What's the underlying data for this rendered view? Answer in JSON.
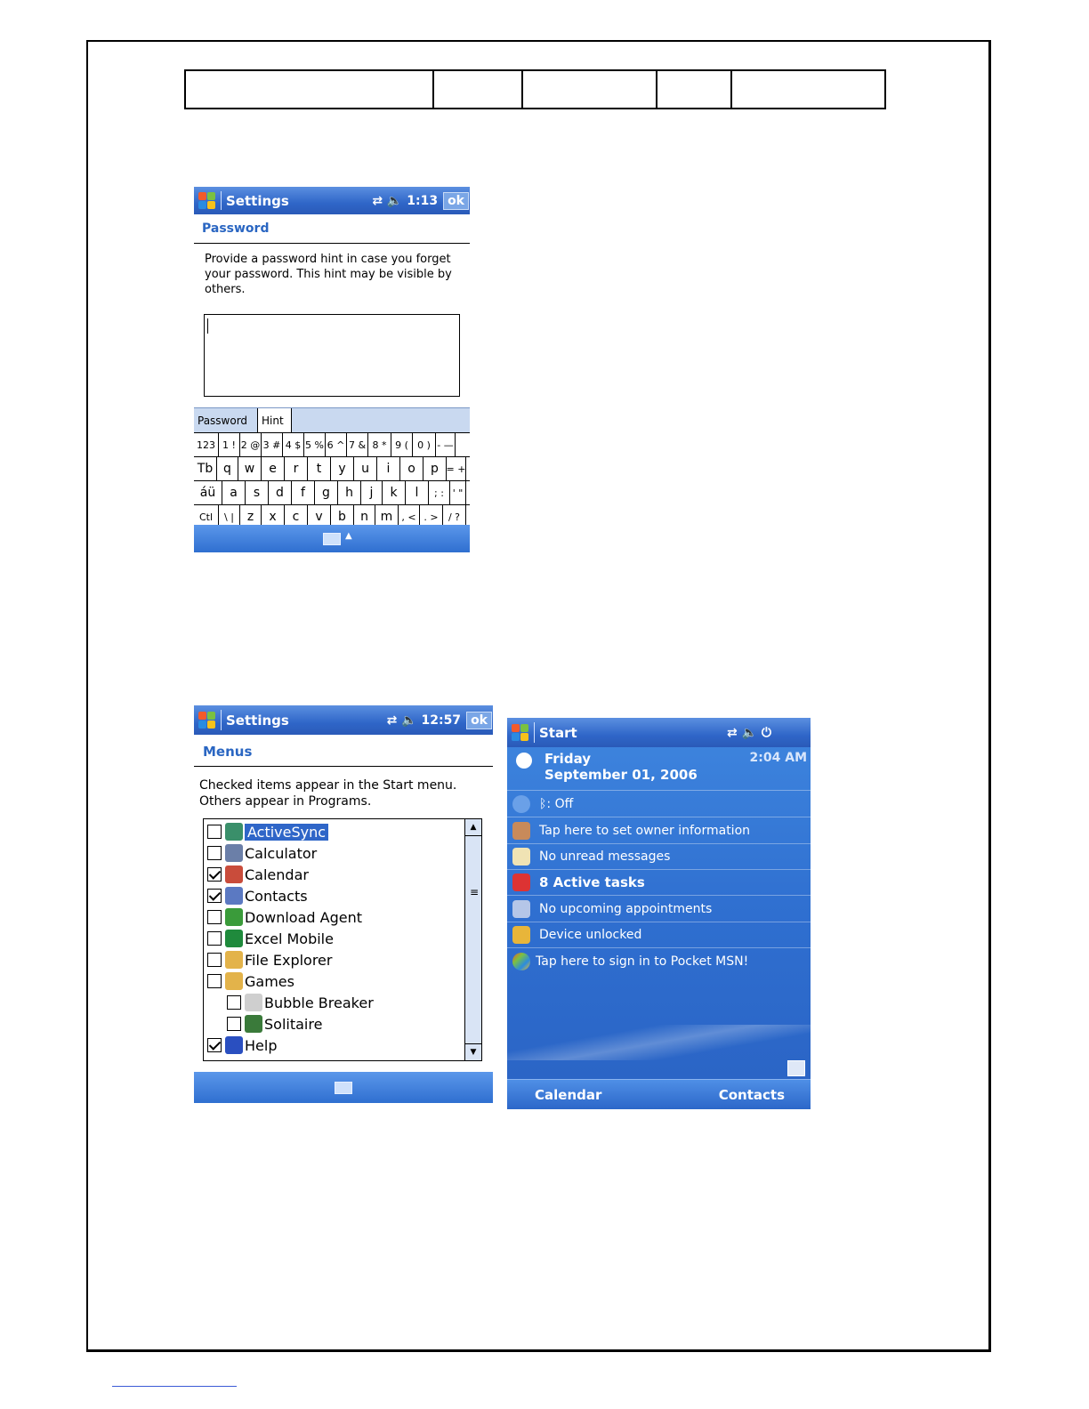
{
  "screen1": {
    "app_title": "Settings",
    "time": "1:13",
    "ok": "ok",
    "heading": "Password",
    "hint_text": "Provide a password hint in case you forget your password.  This hint may be visible by others.",
    "tabs": [
      "Password",
      "Hint"
    ],
    "keyboard_rows": [
      [
        "123",
        "1 !",
        "2 @",
        "3 #",
        "4 $",
        "5 %",
        "6 ^",
        "7 &",
        "8 *",
        "9 (",
        "0 )",
        "- —"
      ],
      [
        "Tb",
        "q",
        "w",
        "e",
        "r",
        "t",
        "y",
        "u",
        "i",
        "o",
        "p",
        "= +"
      ],
      [
        "áü",
        "a",
        "s",
        "d",
        "f",
        "g",
        "h",
        "j",
        "k",
        "l",
        "; :",
        "' \""
      ],
      [
        "Ctl",
        "\\ |",
        "z",
        "x",
        "c",
        "v",
        "b",
        "n",
        "m",
        ", <",
        ". >",
        "/ ?"
      ]
    ]
  },
  "screen2": {
    "app_title": "Settings",
    "time": "12:57",
    "ok": "ok",
    "heading": "Menus",
    "description": "Checked items appear in the Start menu. Others appear in Programs.",
    "items": [
      {
        "label": "ActiveSync",
        "checked": false,
        "indent": false,
        "selected": true,
        "color": "#3a8f6a"
      },
      {
        "label": "Calculator",
        "checked": false,
        "indent": false,
        "selected": false,
        "color": "#6b7fa8"
      },
      {
        "label": "Calendar",
        "checked": true,
        "indent": false,
        "selected": false,
        "color": "#c94c3b"
      },
      {
        "label": "Contacts",
        "checked": true,
        "indent": false,
        "selected": false,
        "color": "#5b79c2"
      },
      {
        "label": "Download Agent",
        "checked": false,
        "indent": false,
        "selected": false,
        "color": "#3a9b3a"
      },
      {
        "label": "Excel Mobile",
        "checked": false,
        "indent": false,
        "selected": false,
        "color": "#1f8a3c"
      },
      {
        "label": "File Explorer",
        "checked": false,
        "indent": false,
        "selected": false,
        "color": "#e3b34a"
      },
      {
        "label": "Games",
        "checked": false,
        "indent": false,
        "selected": false,
        "color": "#e3b34a"
      },
      {
        "label": "Bubble Breaker",
        "checked": false,
        "indent": true,
        "selected": false,
        "color": "#cfcfcf"
      },
      {
        "label": "Solitaire",
        "checked": false,
        "indent": true,
        "selected": false,
        "color": "#3a7a3a"
      },
      {
        "label": "Help",
        "checked": true,
        "indent": false,
        "selected": false,
        "color": "#2a4fc0"
      }
    ]
  },
  "screen3": {
    "app_title": "Start",
    "day": "Friday",
    "date": "September 01, 2006",
    "clock": "2:04 AM",
    "bluetooth": ": Off",
    "owner": "Tap here to set owner information",
    "messages": "No unread messages",
    "tasks": "8 Active tasks",
    "appointments": "No upcoming appointments",
    "lock": "Device unlocked",
    "msn": "Tap here to sign in to Pocket MSN!",
    "softkey_left": "Calendar",
    "softkey_right": "Contacts"
  },
  "colors": {
    "titlebar": "#2f66c8",
    "heading": "#2a66c2",
    "today_bg": "#2f6fd0"
  }
}
